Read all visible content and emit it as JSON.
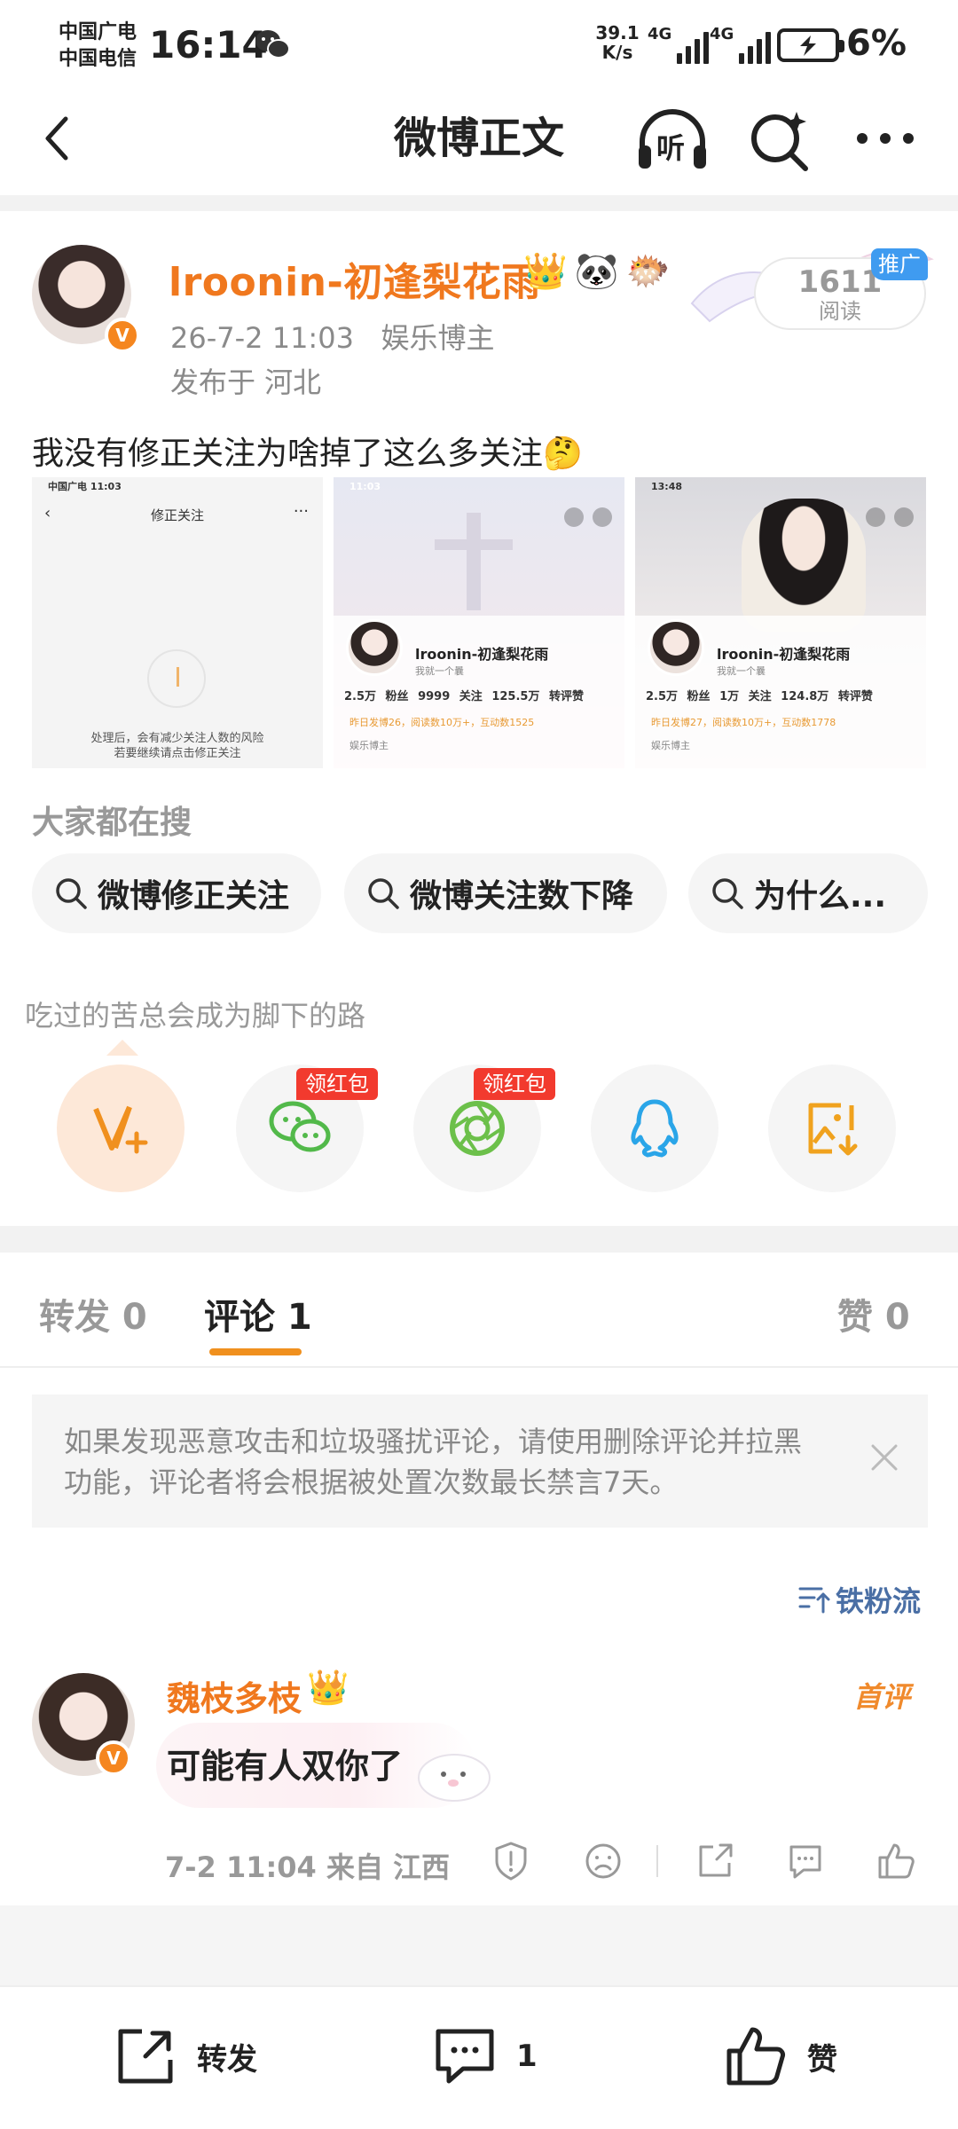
{
  "status_bar": {
    "carrier1": "中国广电",
    "carrier2": "中国电信",
    "time": "16:14",
    "speed_value": "39.1",
    "speed_unit": "K/s",
    "net1": "4G",
    "net2": "4G",
    "battery": "6%"
  },
  "nav": {
    "title": "微博正文",
    "listen_label": "听"
  },
  "post": {
    "username": "lroonin-初逢梨花雨",
    "badge": "V",
    "time": "26-7-2 11:03",
    "role": "娱乐博主",
    "location": "发布于 河北",
    "reads_count": "1611",
    "reads_label": "阅读",
    "promo": "推广",
    "text": "我没有修正关注为啥掉了这么多关注🤔"
  },
  "images": {
    "img1": {
      "status": "中国广电 11:03",
      "title": "修正关注",
      "note1": "处理后，会有减少关注人数的风险",
      "note2": "若要继续请点击修正关注"
    },
    "img2": {
      "status": "11:03",
      "name": "lroonin-初逢梨花雨",
      "sub": "我就一个曩",
      "stats": "2.5万 粉丝  9999 关注  125.5万 转评赞",
      "yellow": "昨日发博26，阅读数10万+，互动数1525",
      "role": "娱乐博主"
    },
    "img3": {
      "status": "13:48",
      "name": "lroonin-初逢梨花雨",
      "sub": "我就一个曩",
      "stats": "2.5万 粉丝  1万 关注  124.8万 转评赞",
      "yellow": "昨日发博27，阅读数10万+，互动数1778",
      "role": "娱乐博主"
    }
  },
  "hot_search": {
    "title": "大家都在搜",
    "chips": [
      "微博修正关注",
      "微博关注数下降",
      "为什么..."
    ]
  },
  "motto": "吃过的苦总会成为脚下的路",
  "share": {
    "redpack1": "领红包",
    "redpack2": "领红包"
  },
  "tabs": {
    "repost": "转发 0",
    "comment": "评论 1",
    "like": "赞 0"
  },
  "notice": "如果发现恶意攻击和垃圾骚扰评论，请使用删除评论并拉黑功能，评论者将会根据被处置次数最长禁言7天。",
  "sort": "铁粉流",
  "comment": {
    "name": "魏枝多枝",
    "tag": "首评",
    "text": "可能有人双你了",
    "meta": "7-2 11:04  来自 江西"
  },
  "bottom_bar": {
    "repost": "转发",
    "comment_count": "1",
    "like": "赞"
  },
  "colors": {
    "accent": "#f0781e",
    "tab_indicator": "#f0901e",
    "promo": "#3f9bf0",
    "redpack": "#f23a2e",
    "sort_link": "#4a6fa5"
  }
}
